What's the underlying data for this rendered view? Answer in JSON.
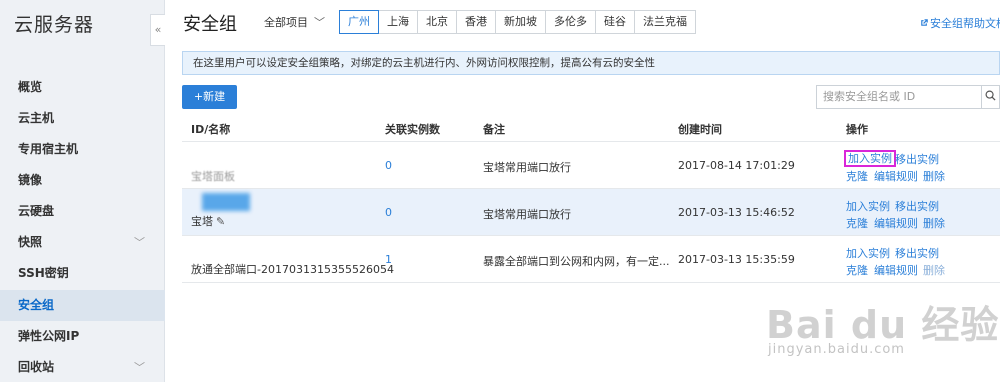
{
  "sidebar": {
    "title": "云服务器",
    "collapse": "«",
    "items": [
      {
        "label": "概览"
      },
      {
        "label": "云主机"
      },
      {
        "label": "专用宿主机"
      },
      {
        "label": "镜像"
      },
      {
        "label": "云硬盘"
      },
      {
        "label": "快照",
        "chevron": "﹀"
      },
      {
        "label": "SSH密钥"
      },
      {
        "label": "安全组",
        "active": true
      },
      {
        "label": "弹性公网IP"
      },
      {
        "label": "回收站",
        "chevron": "﹀"
      }
    ]
  },
  "header": {
    "title": "安全组",
    "project": "全部项目",
    "project_caret": "﹀",
    "regions": [
      "广州",
      "上海",
      "北京",
      "香港",
      "新加坡",
      "多伦多",
      "硅谷",
      "法兰克福"
    ],
    "active_region": "广州",
    "help_label": "安全组帮助文档"
  },
  "info_text": "在这里用户可以设定安全组策略，对绑定的云主机进行内、外网访问权限控制，提高公有云的安全性",
  "toolbar": {
    "new_label": "+新建",
    "search_placeholder": "搜索安全组名或 ID"
  },
  "table": {
    "columns": [
      "ID/名称",
      "关联实例数",
      "备注",
      "创建时间",
      "操作"
    ],
    "rows": [
      {
        "name": "宝塔面板",
        "count": "0",
        "remark": "宝塔常用端口放行",
        "created": "2017-08-14 17:01:29",
        "ops": [
          "加入实例",
          "移出实例",
          "克隆",
          "编辑规则",
          "删除"
        ]
      },
      {
        "name": "宝塔",
        "count": "0",
        "remark": "宝塔常用端口放行",
        "created": "2017-03-13 15:46:52",
        "ops": [
          "加入实例",
          "移出实例",
          "克隆",
          "编辑规则",
          "删除"
        ]
      },
      {
        "name": "放通全部端口-2017031315355526054",
        "count": "1",
        "remark": "暴露全部端口到公网和内网，有一定...",
        "created": "2017-03-13 15:35:59",
        "ops": [
          "加入实例",
          "移出实例",
          "克隆",
          "编辑规则",
          "删除"
        ]
      }
    ]
  },
  "watermark": {
    "logo": "Bai du 经验",
    "url": "jingyan.baidu.com"
  },
  "colors": {
    "accent": "#2b7fd8",
    "highlight_box": "#d926d9",
    "sidebar_bg": "#eef1f5",
    "info_bg": "#e8f2fc"
  }
}
